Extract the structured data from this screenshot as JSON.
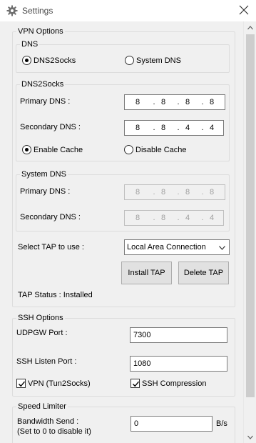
{
  "window": {
    "title": "Settings",
    "icon": "gear-icon",
    "close_icon": "close-icon"
  },
  "vpn": {
    "group_label": "VPN Options",
    "dns": {
      "group_label": "DNS",
      "options": [
        {
          "label": "DNS2Socks",
          "selected": true
        },
        {
          "label": "System DNS",
          "selected": false
        }
      ]
    },
    "dns2socks": {
      "group_label": "DNS2Socks",
      "primary_label": "Primary DNS :",
      "primary_octets": [
        "8",
        "8",
        "8",
        "8"
      ],
      "secondary_label": "Secondary DNS :",
      "secondary_octets": [
        "8",
        "8",
        "4",
        "4"
      ],
      "cache_options": [
        {
          "label": "Enable Cache",
          "selected": true
        },
        {
          "label": "Disable Cache",
          "selected": false
        }
      ]
    },
    "system_dns": {
      "group_label": "System DNS",
      "primary_label": "Primary DNS :",
      "primary_octets": [
        "8",
        "8",
        "8",
        "8"
      ],
      "secondary_label": "Secondary DNS :",
      "secondary_octets": [
        "8",
        "8",
        "4",
        "4"
      ]
    },
    "tap": {
      "select_label": "Select TAP to use :",
      "selected_value": "Local Area Connection",
      "install_button": "Install TAP",
      "delete_button": "Delete TAP",
      "status_text": "TAP Status : Installed"
    }
  },
  "ssh": {
    "group_label": "SSH Options",
    "udpgw_label": "UDPGW Port :",
    "udpgw_value": "7300",
    "listen_label": "SSH Listen Port :",
    "listen_value": "1080",
    "vpn_checkbox": {
      "label": "VPN (Tun2Socks)",
      "checked": true
    },
    "compression_checkbox": {
      "label": "SSH Compression",
      "checked": true
    }
  },
  "speed": {
    "group_label": "Speed Limiter",
    "send_label": "Bandwidth Send :",
    "send_hint": "(Set to 0 to disable it)",
    "send_value": "0",
    "send_unit": "B/s"
  },
  "colors": {
    "window_bg": "#f0f0f0",
    "group_border": "#dcdcdc",
    "scroll_thumb": "#cdcdcd"
  }
}
